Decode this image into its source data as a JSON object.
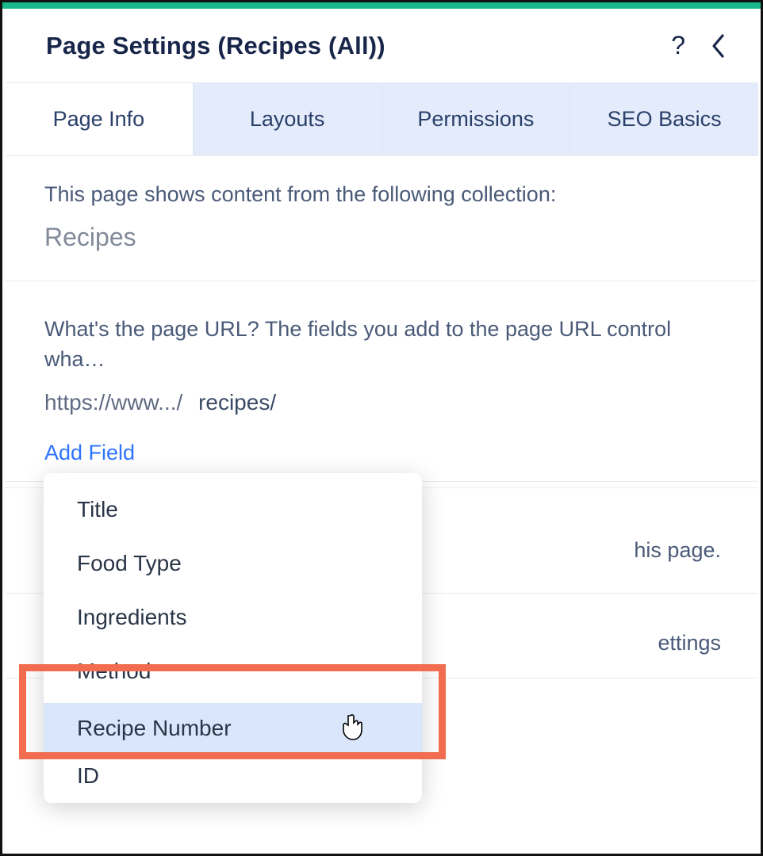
{
  "header": {
    "title": "Page Settings (Recipes (All))"
  },
  "tabs": [
    {
      "label": "Page Info",
      "active": true
    },
    {
      "label": "Layouts",
      "active": false
    },
    {
      "label": "Permissions",
      "active": false
    },
    {
      "label": "SEO Basics",
      "active": false
    }
  ],
  "collection_section": {
    "description": "This page shows content from the following collection:",
    "collection_name": "Recipes"
  },
  "url_section": {
    "question": "What's the page URL? The fields you add to the page URL control wha…",
    "base": "https://www.../",
    "path": "recipes/",
    "add_field_label": "Add Field"
  },
  "behind": {
    "line1": "his page.",
    "line2": "ettings"
  },
  "dropdown": {
    "items": [
      "Title",
      "Food Type",
      "Ingredients",
      "Method",
      "Recipe Number",
      "ID"
    ],
    "hovered_index": 4
  }
}
